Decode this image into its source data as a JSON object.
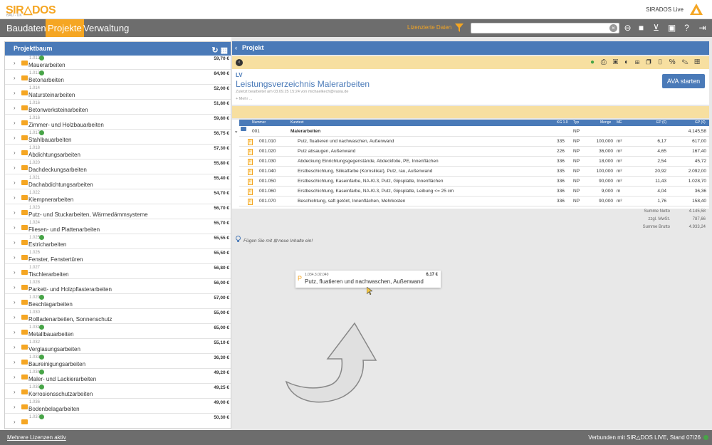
{
  "header": {
    "logo": "SIR△DOS",
    "logo_sub": "BAU - UK",
    "brand_name": "SIRADOS Live"
  },
  "menu": {
    "items": [
      "Baudaten",
      "Projekte",
      "Verwaltung"
    ],
    "active": "Projekte",
    "license_label": "Lizenzierte Daten",
    "search_value": "",
    "icons": [
      "zoom-icon",
      "video-icon",
      "cart-icon",
      "user-icon",
      "help-icon",
      "account-icon",
      "exit-icon"
    ]
  },
  "tree": {
    "title": "Projektbaum",
    "rows": [
      {
        "code": "1.012",
        "name": "Mauerarbeiten",
        "price": "59,70 €",
        "check": true
      },
      {
        "code": "1.013",
        "name": "Betonarbeiten",
        "price": "84,90 €",
        "check": true
      },
      {
        "code": "1.014",
        "name": "Natursteinarbeiten",
        "price": "52,00 €",
        "check": false
      },
      {
        "code": "1.016",
        "name": "Betonwerksteinarbeiten",
        "price": "51,80 €",
        "check": false
      },
      {
        "code": "1.016",
        "name": "Zimmer- und Holzbauarbeiten",
        "price": "59,80 €",
        "check": false
      },
      {
        "code": "1.017",
        "name": "Stahlbauarbeiten",
        "price": "56,75 €",
        "check": true
      },
      {
        "code": "1.018",
        "name": "Abdichtungsarbeiten",
        "price": "57,30 €",
        "check": false
      },
      {
        "code": "1.020",
        "name": "Dachdeckungsarbeiten",
        "price": "55,80 €",
        "check": false
      },
      {
        "code": "1.021",
        "name": "Dachabdichtungsarbeiten",
        "price": "55,40 €",
        "check": false
      },
      {
        "code": "1.022",
        "name": "Klempnerarbeiten",
        "price": "54,70 €",
        "check": false
      },
      {
        "code": "1.023",
        "name": "Putz- und Stuckarbeiten, Wärmedämmsysteme",
        "price": "56,70 €",
        "check": false
      },
      {
        "code": "1.024",
        "name": "Fliesen- und Plattenarbeiten",
        "price": "55,70 €",
        "check": false
      },
      {
        "code": "1.025",
        "name": "Estricharbeiten",
        "price": "55,55 €",
        "check": true
      },
      {
        "code": "1.026",
        "name": "Fenster, Fenstertüren",
        "price": "55,50 €",
        "check": false
      },
      {
        "code": "1.027",
        "name": "Tischlerarbeiten",
        "price": "56,80 €",
        "check": false
      },
      {
        "code": "1.028",
        "name": "Parkett- und Holzpflasterarbeiten",
        "price": "56,00 €",
        "check": false
      },
      {
        "code": "1.029",
        "name": "Beschlagarbeiten",
        "price": "57,00 €",
        "check": true
      },
      {
        "code": "1.030",
        "name": "Rollladenarbeiten, Sonnenschutz",
        "price": "55,00 €",
        "check": false
      },
      {
        "code": "1.031",
        "name": "Metallbauarbeiten",
        "price": "65,00 €",
        "check": true
      },
      {
        "code": "1.032",
        "name": "Verglasungsarbeiten",
        "price": "55,10 €",
        "check": false
      },
      {
        "code": "1.033",
        "name": "Baureinigungsarbeiten",
        "price": "36,30 €",
        "check": true
      },
      {
        "code": "1.034",
        "name": "Maler- und Lackierarbeiten",
        "price": "49,20 €",
        "check": true
      },
      {
        "code": "1.035",
        "name": "Korrosionsschutzarbeiten",
        "price": "49,25 €",
        "check": true
      },
      {
        "code": "1.036",
        "name": "Bodenbelagarbeiten",
        "price": "49,00 €",
        "check": false
      },
      {
        "code": "1.037",
        "name": "",
        "price": "50,30 €",
        "check": true
      }
    ]
  },
  "project": {
    "title": "Projekt",
    "lv_tag": "LV",
    "lv_title": "Leistungsverzeichnis Malerarbeiten",
    "lv_sub": "Zuletzt bearbeitet am 03.09.25 15:24 von michaelkech@vasia.de",
    "lv_more": "+ Mehr ...",
    "ava_button": "AVA starten",
    "tools": [
      "download-icon",
      "print-icon",
      "lock-icon",
      "shield-icon",
      "add-icon",
      "copy-icon",
      "trash-icon",
      "percent-icon",
      "edit-icon",
      "table-icon"
    ]
  },
  "positions": {
    "headers": {
      "nummer": "Nummer",
      "kurztext": "Kurztext",
      "kg": "KG 1.0",
      "typ": "Typ",
      "menge": "Menge",
      "me": "ME",
      "ep": "EP (€)",
      "gp": "GP (€)"
    },
    "group": {
      "nummer": "001",
      "kurztext": "Malerarbeiten",
      "typ": "NP",
      "gp": "4.145,58"
    },
    "rows": [
      {
        "nummer": "001.010",
        "kurztext": "Putz, fluatieren und nachwaschen, Außenwand",
        "kg": "335",
        "typ": "NP",
        "menge": "100,000",
        "me": "m²",
        "ep": "6,17",
        "gp": "617,00"
      },
      {
        "nummer": "001.020",
        "kurztext": "Putz absaugen, Außenwand",
        "kg": "226",
        "typ": "NP",
        "menge": "36,000",
        "me": "m²",
        "ep": "4,65",
        "gp": "167,40"
      },
      {
        "nummer": "001.030",
        "kurztext": "Abdeckung Einrichtungsgegenstände, Abdeckfolie, PE, Innenflächen",
        "kg": "336",
        "typ": "NP",
        "menge": "18,000",
        "me": "m²",
        "ep": "2,54",
        "gp": "45,72"
      },
      {
        "nummer": "001.040",
        "kurztext": "Erstbeschichtung, Silikatfarbe (Kornsilikat), Putz, rau, Außenwand",
        "kg": "335",
        "typ": "NP",
        "menge": "100,000",
        "me": "m²",
        "ep": "20,92",
        "gp": "2.092,00"
      },
      {
        "nummer": "001.050",
        "kurztext": "Erstbeschichtung, Kaseinfarbe, NA-Kl.3, Putz, Gipsplatte, Innenflächen",
        "kg": "336",
        "typ": "NP",
        "menge": "90,000",
        "me": "m²",
        "ep": "11,43",
        "gp": "1.028,70"
      },
      {
        "nummer": "001.060",
        "kurztext": "Erstbeschichtung, Kaseinfarbe, NA-Kl.3, Putz, Gipsplatte, Leibung <= 25 cm",
        "kg": "336",
        "typ": "NP",
        "menge": "9,000",
        "me": "m",
        "ep": "4,04",
        "gp": "36,36"
      },
      {
        "nummer": "001.070",
        "kurztext": "Beschichtung, saft getönt, Innenflächen, Mehrkosten",
        "kg": "336",
        "typ": "NP",
        "menge": "90,000",
        "me": "m²",
        "ep": "1,76",
        "gp": "158,40"
      }
    ],
    "totals": [
      {
        "label": "Summe Netto",
        "value": "4.145,58"
      },
      {
        "label": "zzgl. MwSt.",
        "value": "787,66"
      },
      {
        "label": "Summe Brutto",
        "value": "4.933,24"
      }
    ],
    "hint": "Fügen Sie mit ⊞ neue Inhalte ein!"
  },
  "drag": {
    "code": "1.034.3.02.040",
    "text": "Putz, fluatieren und nachwaschen, Außenwand",
    "price": "6,17 €"
  },
  "footer": {
    "left": "Mehrere Lizenzen aktiv",
    "right": "Verbunden mit SIR△DOS LIVE, Stand 07/26"
  },
  "colors": {
    "accent": "#f5a623",
    "primary": "#4a7ab8",
    "bar": "#6d6d6d",
    "ok": "#47a447"
  }
}
